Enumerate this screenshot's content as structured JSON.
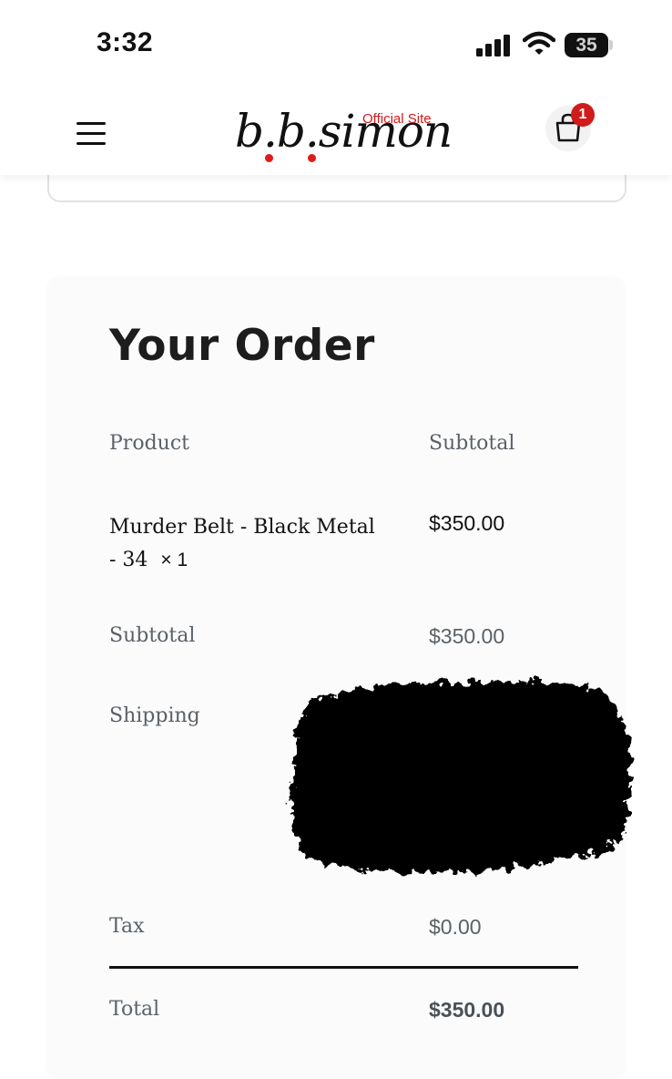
{
  "status_bar": {
    "time": "3:32",
    "battery_level": "35"
  },
  "header": {
    "logo_text": "b.b.simon",
    "logo_tagline": "Official Site",
    "cart_count": "1",
    "accent_color": "#d11a1a"
  },
  "order": {
    "title": "Your Order",
    "columns": {
      "product": "Product",
      "subtotal": "Subtotal"
    },
    "items": [
      {
        "name": "Murder Belt - Black Metal - 34",
        "quantity": "× 1",
        "subtotal": "$350.00"
      }
    ],
    "summary": {
      "subtotal_label": "Subtotal",
      "subtotal_value": "$350.00",
      "shipping_label": "Shipping",
      "tax_label": "Tax",
      "tax_value": "$0.00",
      "total_label": "Total",
      "total_value": "$350.00"
    }
  },
  "icons": {
    "menu": "hamburger-menu-icon",
    "cart": "shopping-bag-icon",
    "signal": "cellular-signal-icon",
    "wifi": "wifi-icon",
    "battery": "battery-icon"
  }
}
